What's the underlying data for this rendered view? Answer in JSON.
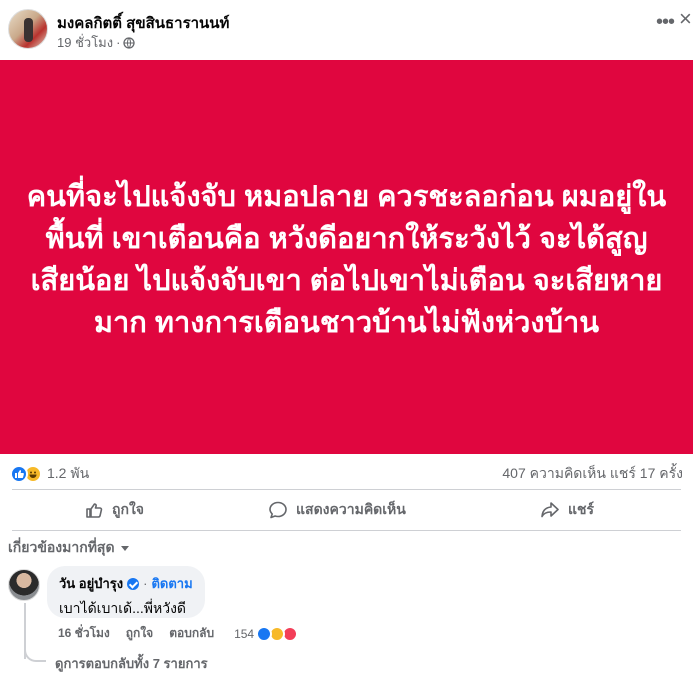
{
  "post": {
    "author": "มงคลกิตติ์ สุขสินธารานนท์",
    "time": "19 ชั่วโมง",
    "separator": "·",
    "audience_icon": "globe-icon",
    "more_icon": "ellipsis-icon",
    "close_icon": "close-icon",
    "banner_text": "คนที่จะไปแจ้งจับ หมอปลาย ควรชะลอก่อน ผมอยู่ในพื้นที่ เขาเตือนคือ หวังดีอยากให้ระวังไว้ จะได้สูญเสียน้อย ไปแจ้งจับเขา ต่อไปเขาไม่เตือน จะเสียหายมาก ทางการเตือนชาวบ้านไม่ฟังห่วงบ้าน",
    "banner_color": "#e0063f"
  },
  "stats": {
    "reactions_count": "1.2 พัน",
    "reaction_icons": [
      "like-icon",
      "haha-icon"
    ],
    "comments_shares": "407 ความคิดเห็น  แชร์ 17 ครั้ง"
  },
  "actions": {
    "like": "ถูกใจ",
    "comment": "แสดงความคิดเห็น",
    "share": "แชร์"
  },
  "comments": {
    "sort_label": "เกี่ยวข้องมากที่สุด",
    "items": [
      {
        "name": "วัน อยู่บำรุง",
        "follow": "ติดตาม",
        "text": "เบาได้เบาเด้...พี่หวังดี",
        "time": "16 ชั่วโมง",
        "like": "ถูกใจ",
        "reply": "ตอบกลับ",
        "reaction_count": "154",
        "reaction_icons": [
          "like-icon",
          "haha-icon",
          "love-icon"
        ]
      }
    ],
    "view_replies": "ดูการตอบกลับทั้ง 7 รายการ"
  },
  "colors": {
    "accent": "#1877f2",
    "secondary_text": "#65676b"
  }
}
